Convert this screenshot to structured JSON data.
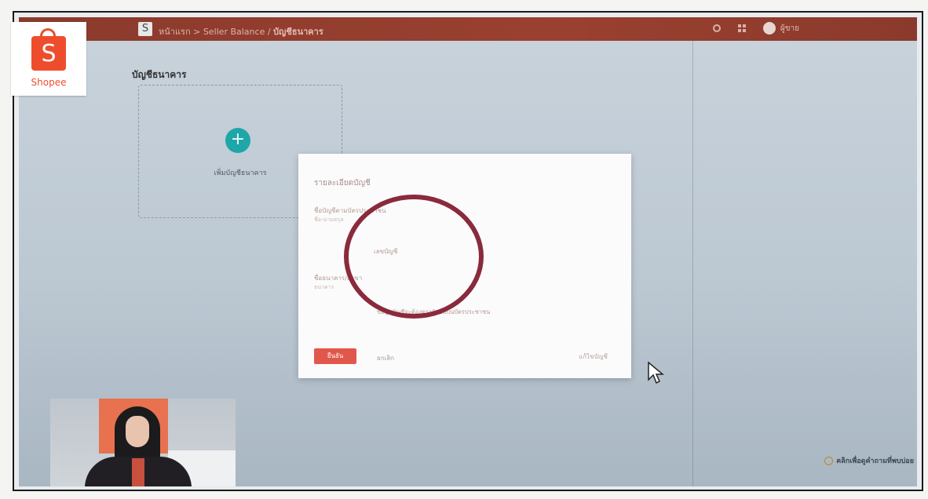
{
  "header": {
    "logo_letter": "S",
    "breadcrumb_parent": "หน้าแรก > Seller Balance /",
    "breadcrumb_current": "บัญชีธนาคาร",
    "user_name": "ผู้ขาย"
  },
  "logo": {
    "letter": "S",
    "wordmark": "Shopee",
    "brand_color": "#ee4d2d"
  },
  "page": {
    "title": "บัญชีธนาคาร",
    "add_card_label": "เพิ่มบัญชีธนาคาร",
    "add_icon": "+"
  },
  "modal": {
    "title": "รายละเอียดบัญชี",
    "row1_label": "ชื่อบัญชีตามบัตรประชาชน",
    "row1_sub": "ชื่อ-นามสกุล",
    "row2_label": "เลขบัญชี",
    "row3_label": "ชื่อธนาคาร/สาขา",
    "row3_sub": "ธนาคาร",
    "note": "ข้อมูลบัญชีจะต้องตรงกับชื่อบนบัตรประชาชน",
    "primary_button": "ยืนยัน",
    "secondary_button": "ยกเลิก",
    "right_link": "แก้ไขบัญชี"
  },
  "footer": {
    "help_link": "คลิกเพื่อดูคำถามที่พบบ่อย"
  },
  "colors": {
    "topbar": "#8a3a2c",
    "accent": "#ee4d2d",
    "teal": "#1fa6a8",
    "annotation_circle": "#8a2a3c"
  }
}
